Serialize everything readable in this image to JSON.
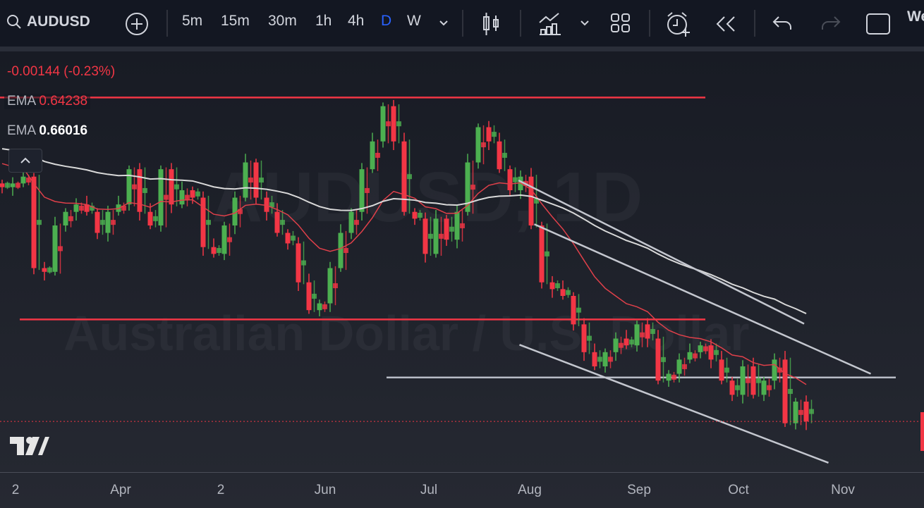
{
  "toolbar": {
    "symbol": "AUDUSD",
    "intervals": [
      "5m",
      "15m",
      "30m",
      "1h",
      "4h",
      "D",
      "W"
    ],
    "active_interval": "D",
    "cut_text": "We"
  },
  "legend": {
    "change": "-0.00144 (-0.23%)",
    "ema1_label": "EMA",
    "ema1_value": "0.64238",
    "ema2_label": "EMA",
    "ema2_value": "0.66016"
  },
  "watermark": {
    "line1": "AUDUSD, 1D",
    "line2": "Australian Dollar / U.S. Dollar"
  },
  "x_axis": [
    "2",
    "Apr",
    "2",
    "Jun",
    "Jul",
    "Aug",
    "Sep",
    "Oct",
    "Nov"
  ],
  "colors": {
    "up": "#4caf50",
    "down": "#f23645",
    "ema_fast": "#e0404a",
    "ema_slow": "#d9d9d9",
    "level_red": "#f23645",
    "level_grey": "#b8bcc6",
    "bg": "#131722"
  },
  "chart_data": {
    "type": "candlestick",
    "ylim": [
      0.6194,
      0.6878
    ],
    "closes": [
      0.6655,
      0.6661,
      0.6672,
      0.6524,
      0.6518,
      0.6593,
      0.6615,
      0.6627,
      0.6615,
      0.6581,
      0.6615,
      0.6627,
      0.6684,
      0.6615,
      0.6593,
      0.6684,
      0.6627,
      0.665,
      0.6638,
      0.6558,
      0.6547,
      0.6593,
      0.6638,
      0.6695,
      0.6638,
      0.6615,
      0.6581,
      0.6564,
      0.6501,
      0.6456,
      0.6467,
      0.6524,
      0.6581,
      0.6615,
      0.6684,
      0.6729,
      0.6786,
      0.6729,
      0.6615,
      0.6604,
      0.6547,
      0.6604,
      0.657,
      0.6615,
      0.6695,
      0.6752,
      0.6729,
      0.6684,
      0.665,
      0.6672,
      0.6593,
      0.6501,
      0.649,
      0.6479,
      0.6433,
      0.6388,
      0.6365,
      0.6388,
      0.641,
      0.6399,
      0.6433,
      0.641,
      0.6342,
      0.6353,
      0.6376,
      0.6388,
      0.6399,
      0.6376,
      0.6342,
      0.6319,
      0.6365,
      0.6319,
      0.6342,
      0.6376,
      0.6273,
      0.6308,
      0.6276
    ],
    "last_price": 0.6276,
    "levels": [
      {
        "price": 0.68,
        "color": "red"
      },
      {
        "price": 0.6441,
        "color": "red"
      },
      {
        "price": 0.6347,
        "color": "grey"
      }
    ],
    "trendlines": [
      {
        "from": [
          50.5,
          0.6595
        ],
        "to": [
          82.3,
          0.6353
        ]
      },
      {
        "from": [
          49.1,
          0.64
        ],
        "to": [
          78.3,
          0.6209
        ]
      },
      {
        "from": [
          49,
          0.6666
        ],
        "to": [
          76,
          0.6434
        ]
      }
    ]
  }
}
